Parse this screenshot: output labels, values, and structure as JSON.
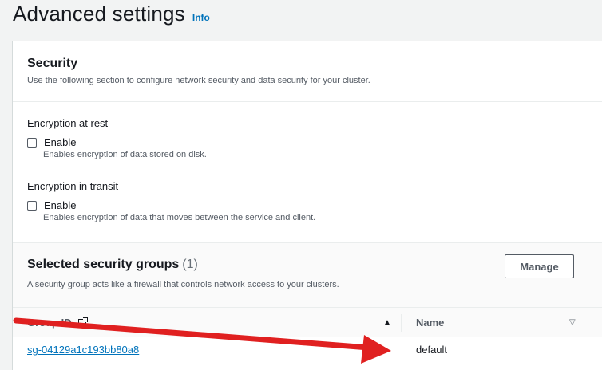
{
  "header": {
    "title": "Advanced settings",
    "info_label": "Info"
  },
  "security": {
    "title": "Security",
    "description": "Use the following section to configure network security and data security for your cluster.",
    "encryption_at_rest": {
      "label": "Encryption at rest",
      "checkbox_label": "Enable",
      "checked": false,
      "hint": "Enables encryption of data stored on disk."
    },
    "encryption_in_transit": {
      "label": "Encryption in transit",
      "checkbox_label": "Enable",
      "checked": false,
      "hint": "Enables encryption of data that moves between the service and client."
    }
  },
  "security_groups": {
    "title": "Selected security groups",
    "count": "(1)",
    "manage_label": "Manage",
    "description": "A security group acts like a firewall that controls network access to your clusters.",
    "columns": [
      "Group ID",
      "Name"
    ],
    "rows": [
      {
        "group_id": "sg-04129a1c193bb80a8",
        "name": "default"
      }
    ]
  },
  "annotation": {
    "arrow_color": "#e02020"
  },
  "colors": {
    "link": "#0073bb",
    "text": "#16191f",
    "muted": "#545b64"
  }
}
